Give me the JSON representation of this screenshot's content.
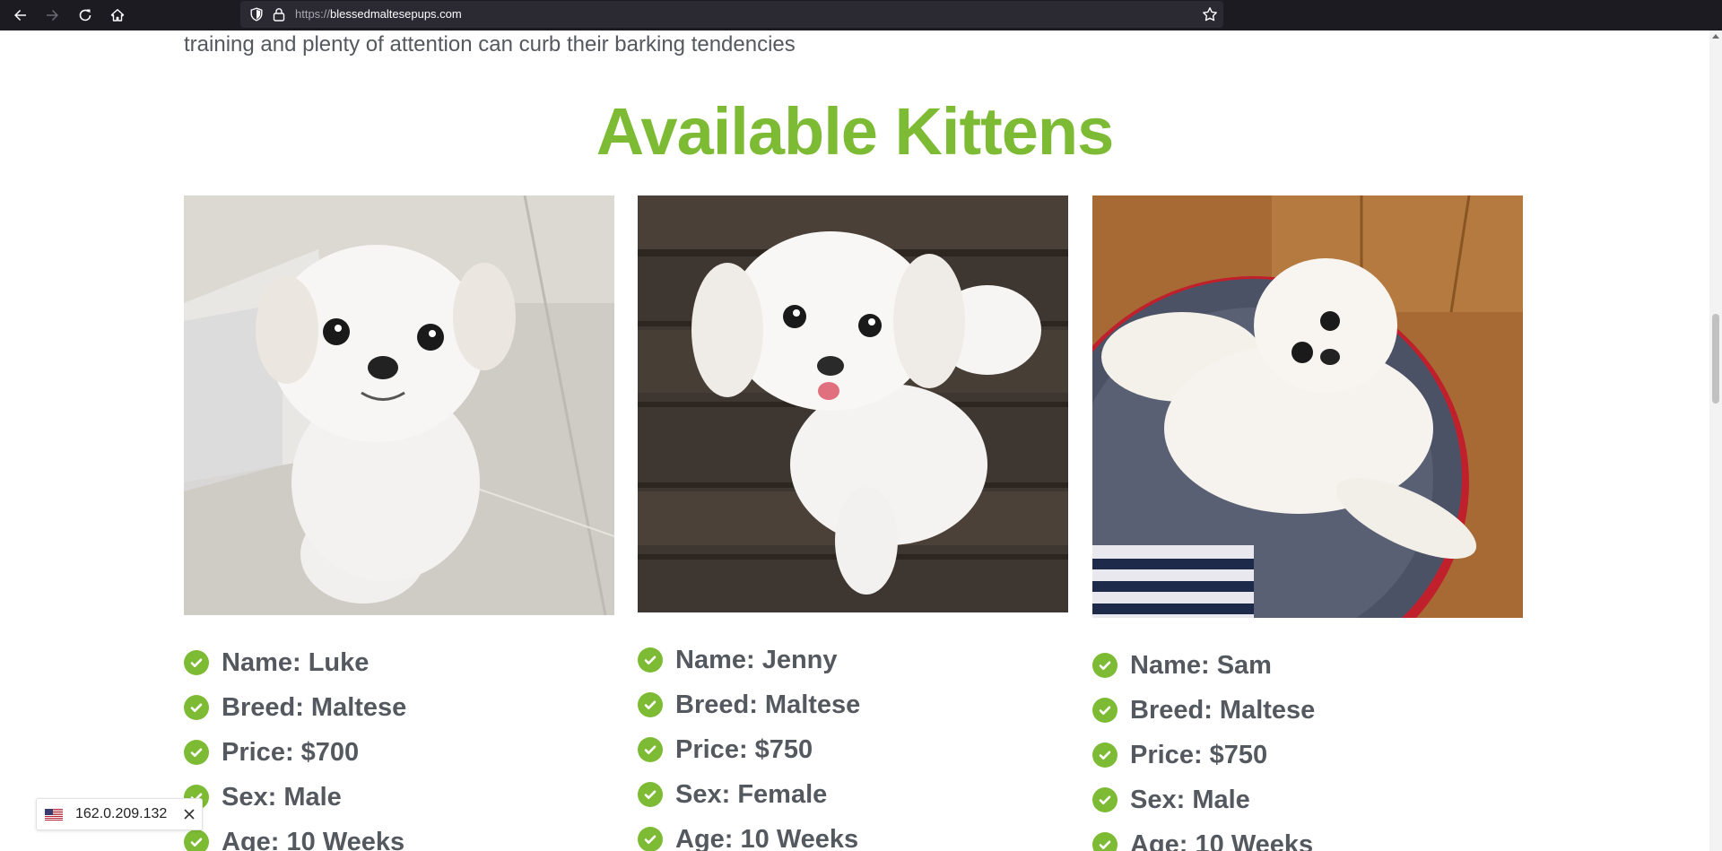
{
  "browser": {
    "url_protocol": "https://",
    "url_host": "blessedmaltesepups.com"
  },
  "page": {
    "intro_text": "training and plenty of attention can curb their barking tendencies",
    "section_title": "Available Kittens",
    "cards": [
      {
        "photo_alt": "White Maltese puppy standing on tile floor",
        "details": [
          "Name: Luke",
          "Breed: Maltese",
          "Price: $700",
          "Sex: Male",
          "Age: 10 Weeks"
        ]
      },
      {
        "photo_alt": "White Maltese puppy sitting on dark wooden floor",
        "details": [
          "Name: Jenny",
          "Breed: Maltese",
          "Price: $750",
          "Sex: Female",
          "Age: 10 Weeks"
        ]
      },
      {
        "photo_alt": "White Maltese puppy lying on a round pet bed",
        "details": [
          "Name: Sam",
          "Breed: Maltese",
          "Price: $750",
          "Sex: Male",
          "Age: 10 Weeks"
        ]
      }
    ]
  },
  "ip_badge": {
    "ip": "162.0.209.132",
    "flag_icon": "us-flag-icon"
  },
  "colors": {
    "accent_green": "#7dbb34",
    "text_gray": "#54595f",
    "toolbar_bg": "#1c1b22"
  }
}
